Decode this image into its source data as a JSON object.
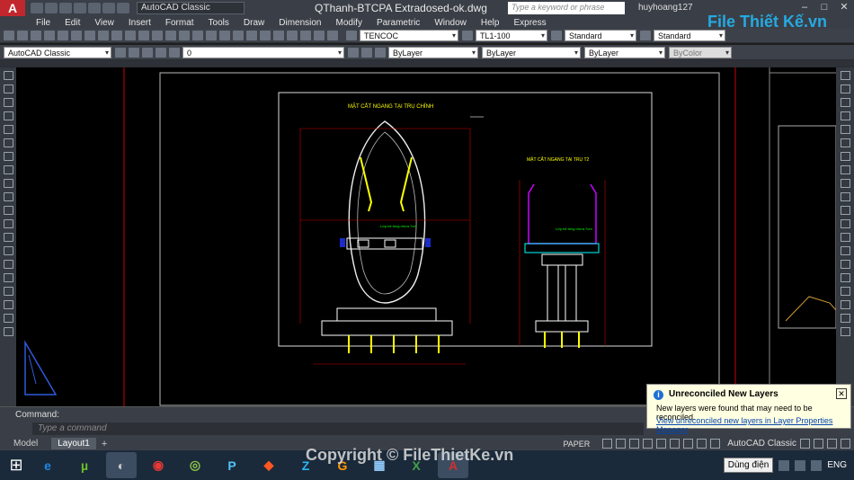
{
  "app": {
    "logo": "A",
    "workspace": "AutoCAD Classic",
    "title": "QThanh-BTCPA Extradosed-ok.dwg",
    "search_placeholder": "Type a keyword or phrase",
    "user": "huyhoang127",
    "brand_logo": "File Thiết Kế.vn"
  },
  "menu": [
    "File",
    "Edit",
    "View",
    "Insert",
    "Format",
    "Tools",
    "Draw",
    "Dimension",
    "Modify",
    "Parametric",
    "Window",
    "Help",
    "Express"
  ],
  "toolbar1": {
    "text_style": "TENCOC",
    "dim_style": "TL1-100",
    "table_style": "Standard",
    "mleader_style": "Standard"
  },
  "toolbar2": {
    "workspace": "AutoCAD Classic",
    "layer": "0",
    "color": "ByLayer",
    "linetype": "ByLayer",
    "lineweight": "ByLayer",
    "plotstyle": "ByColor"
  },
  "drawing": {
    "title_main": "MẶT CẮT NGANG TẠI TRỤ CHÍNH",
    "title_secondary": "MẶT CẮT NGANG TẠI TRỤ T2",
    "label_beam_main": "Lớp bê tông nhựa 7cm",
    "label_beam_secondary": "Lớp bê tông nhựa 7cm"
  },
  "command": {
    "label": "Command:",
    "placeholder": "Type a command"
  },
  "tabs": [
    "Model",
    "Layout1"
  ],
  "active_tab": "Layout1",
  "status": {
    "paper": "PAPER",
    "workspace": "AutoCAD Classic"
  },
  "notification": {
    "title": "Unreconciled New Layers",
    "message": "New layers were found that may need to be reconciled.",
    "link": "View unreconciled new layers in Layer Properties Manager"
  },
  "watermark": "Copyright © FileThietKe.vn",
  "taskbar": {
    "apps": [
      "ie",
      "utorrent",
      "generic",
      "chrome",
      "sync",
      "p-app",
      "foxit",
      "zalo",
      "pdf",
      "calc",
      "excel",
      "autocad"
    ],
    "tray_tip": "Dùng điện",
    "language": "ENG"
  }
}
